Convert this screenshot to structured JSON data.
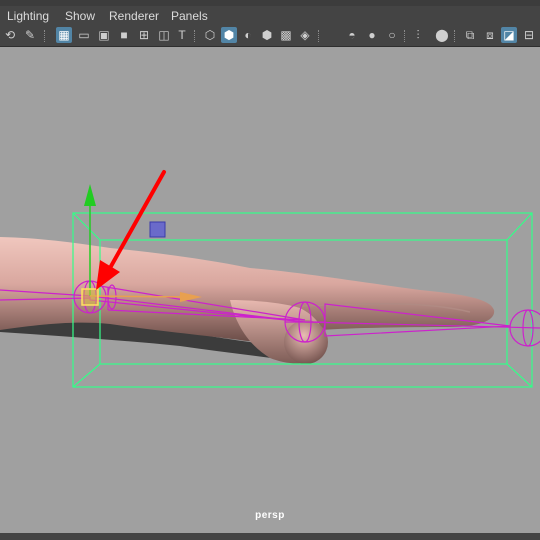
{
  "menubar": {
    "items": [
      {
        "label": "Lighting"
      },
      {
        "label": "Show"
      },
      {
        "label": "Renderer"
      },
      {
        "label": "Panels"
      }
    ]
  },
  "toolbar": {
    "icons": [
      "move-camera-icon",
      "bookmark-icon",
      "grid-icon",
      "film-gate-icon",
      "resolution-gate-icon",
      "gate-mask-icon",
      "field-chart-icon",
      "safe-action-icon",
      "safe-title-icon",
      "wireframe-icon",
      "smooth-shade-icon",
      "default-material-icon",
      "wireframe-on-shaded-icon",
      "xray-icon",
      "use-all-lights-icon",
      "shadows-icon",
      "screen-space-ao-icon",
      "motion-blur-icon",
      "isolate-select-icon",
      "xray-joints-icon",
      "xray-active-components-icon",
      "camera-attributes-icon"
    ],
    "active_icon": "grid-icon",
    "active_color": "#5285a6"
  },
  "viewport": {
    "camera_label": "persp",
    "background_color": "#a0a0a0",
    "selection_color": "#33ff88",
    "joint_color": "#cc22cc",
    "annotation_arrow_color": "#ff0000",
    "mesh_color": "#e8b4ac"
  }
}
